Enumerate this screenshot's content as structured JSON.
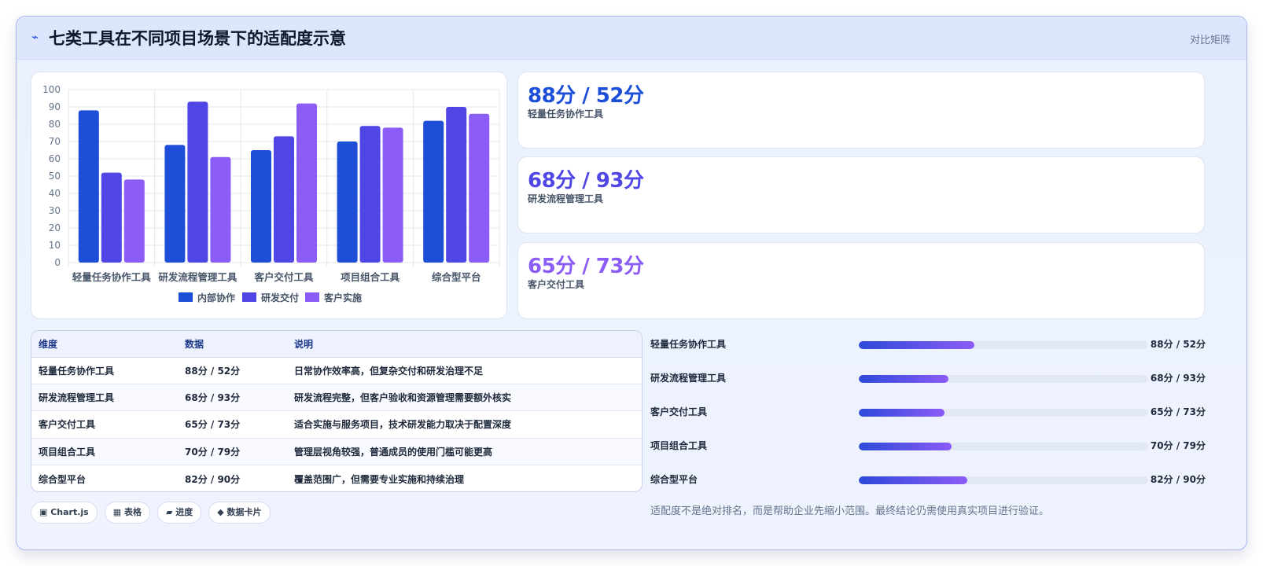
{
  "header": {
    "icon": "bolt-icon",
    "title": "七类工具在不同项目场景下的适配度示意",
    "tag": "对比矩阵"
  },
  "chart_data": {
    "type": "bar",
    "categories": [
      "轻量任务协作工具",
      "研发流程管理工具",
      "客户交付工具",
      "项目组合工具",
      "综合型平台"
    ],
    "series": [
      {
        "name": "内部协作",
        "values": [
          88,
          68,
          65,
          70,
          82
        ],
        "color": "#1d4ed8"
      },
      {
        "name": "研发交付",
        "values": [
          52,
          93,
          73,
          79,
          90
        ],
        "color": "#4f46e5"
      },
      {
        "name": "客户实施",
        "values": [
          48,
          61,
          92,
          78,
          86
        ],
        "color": "#8b5cf6"
      }
    ],
    "yticks": [
      "0",
      "10",
      "20",
      "30",
      "40",
      "50",
      "60",
      "70",
      "80",
      "90",
      "100"
    ],
    "ylim": [
      0,
      100
    ],
    "grid": true,
    "legend": "bottom"
  },
  "stats": [
    {
      "value": "88分 / 52分",
      "label": "轻量任务协作工具",
      "color": "#1d4ed8"
    },
    {
      "value": "68分 / 93分",
      "label": "研发流程管理工具",
      "color": "#4f46e5"
    },
    {
      "value": "65分 / 73分",
      "label": "客户交付工具",
      "color": "#8b5cf6"
    }
  ],
  "table": {
    "headers": [
      "维度",
      "数据",
      "说明"
    ],
    "rows": [
      [
        "轻量任务协作工具",
        "88分 / 52分",
        "日常协作效率高，但复杂交付和研发治理不足"
      ],
      [
        "研发流程管理工具",
        "68分 / 93分",
        "研发流程完整，但客户验收和资源管理需要额外核实"
      ],
      [
        "客户交付工具",
        "65分 / 73分",
        "适合实施与服务项目，技术研发能力取决于配置深度"
      ],
      [
        "项目组合工具",
        "70分 / 79分",
        "管理层视角较强，普通成员的使用门槛可能更高"
      ],
      [
        "综合型平台",
        "82分 / 90分",
        "覆盖范围广，但需要专业实施和持续治理"
      ]
    ]
  },
  "chips": [
    "▣ Chart.js",
    "▦ 表格",
    "▰ 进度",
    "◆ 数据卡片"
  ],
  "progress": [
    {
      "name": "轻量任务协作工具",
      "value": "88分 / 52分",
      "fill": 0.4
    },
    {
      "name": "研发流程管理工具",
      "value": "68分 / 93分",
      "fill": 0.31
    },
    {
      "name": "客户交付工具",
      "value": "65分 / 73分",
      "fill": 0.295
    },
    {
      "name": "项目组合工具",
      "value": "70分 / 79分",
      "fill": 0.32
    },
    {
      "name": "综合型平台",
      "value": "82分 / 90分",
      "fill": 0.375
    }
  ],
  "note": "适配度不是绝对排名，而是帮助企业先缩小范围。最终结论仍需使用真实项目进行验证。"
}
